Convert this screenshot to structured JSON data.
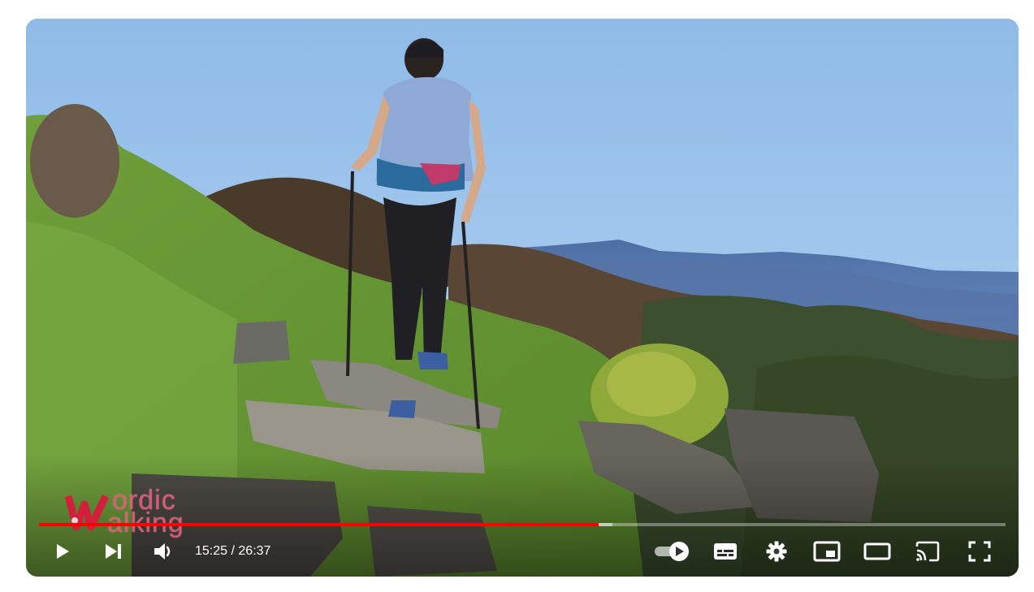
{
  "video": {
    "watermark_line1": "ordic",
    "watermark_line2": "alking",
    "watermark_mark": "W"
  },
  "player": {
    "current_time": "15:25",
    "separator": " / ",
    "duration": "26:37",
    "progress_fraction": 0.579,
    "buffered_fraction": 0.593,
    "progress_color": "#ff0000",
    "autoplay": true
  },
  "icons": {
    "play": "play-icon",
    "next": "next-icon",
    "volume": "volume-icon",
    "autoplay": "autoplay-toggle-icon",
    "subtitles": "subtitles-icon",
    "settings": "settings-gear-icon",
    "miniplayer": "miniplayer-icon",
    "theater": "theater-mode-icon",
    "cast": "cast-icon",
    "fullscreen": "fullscreen-icon"
  }
}
